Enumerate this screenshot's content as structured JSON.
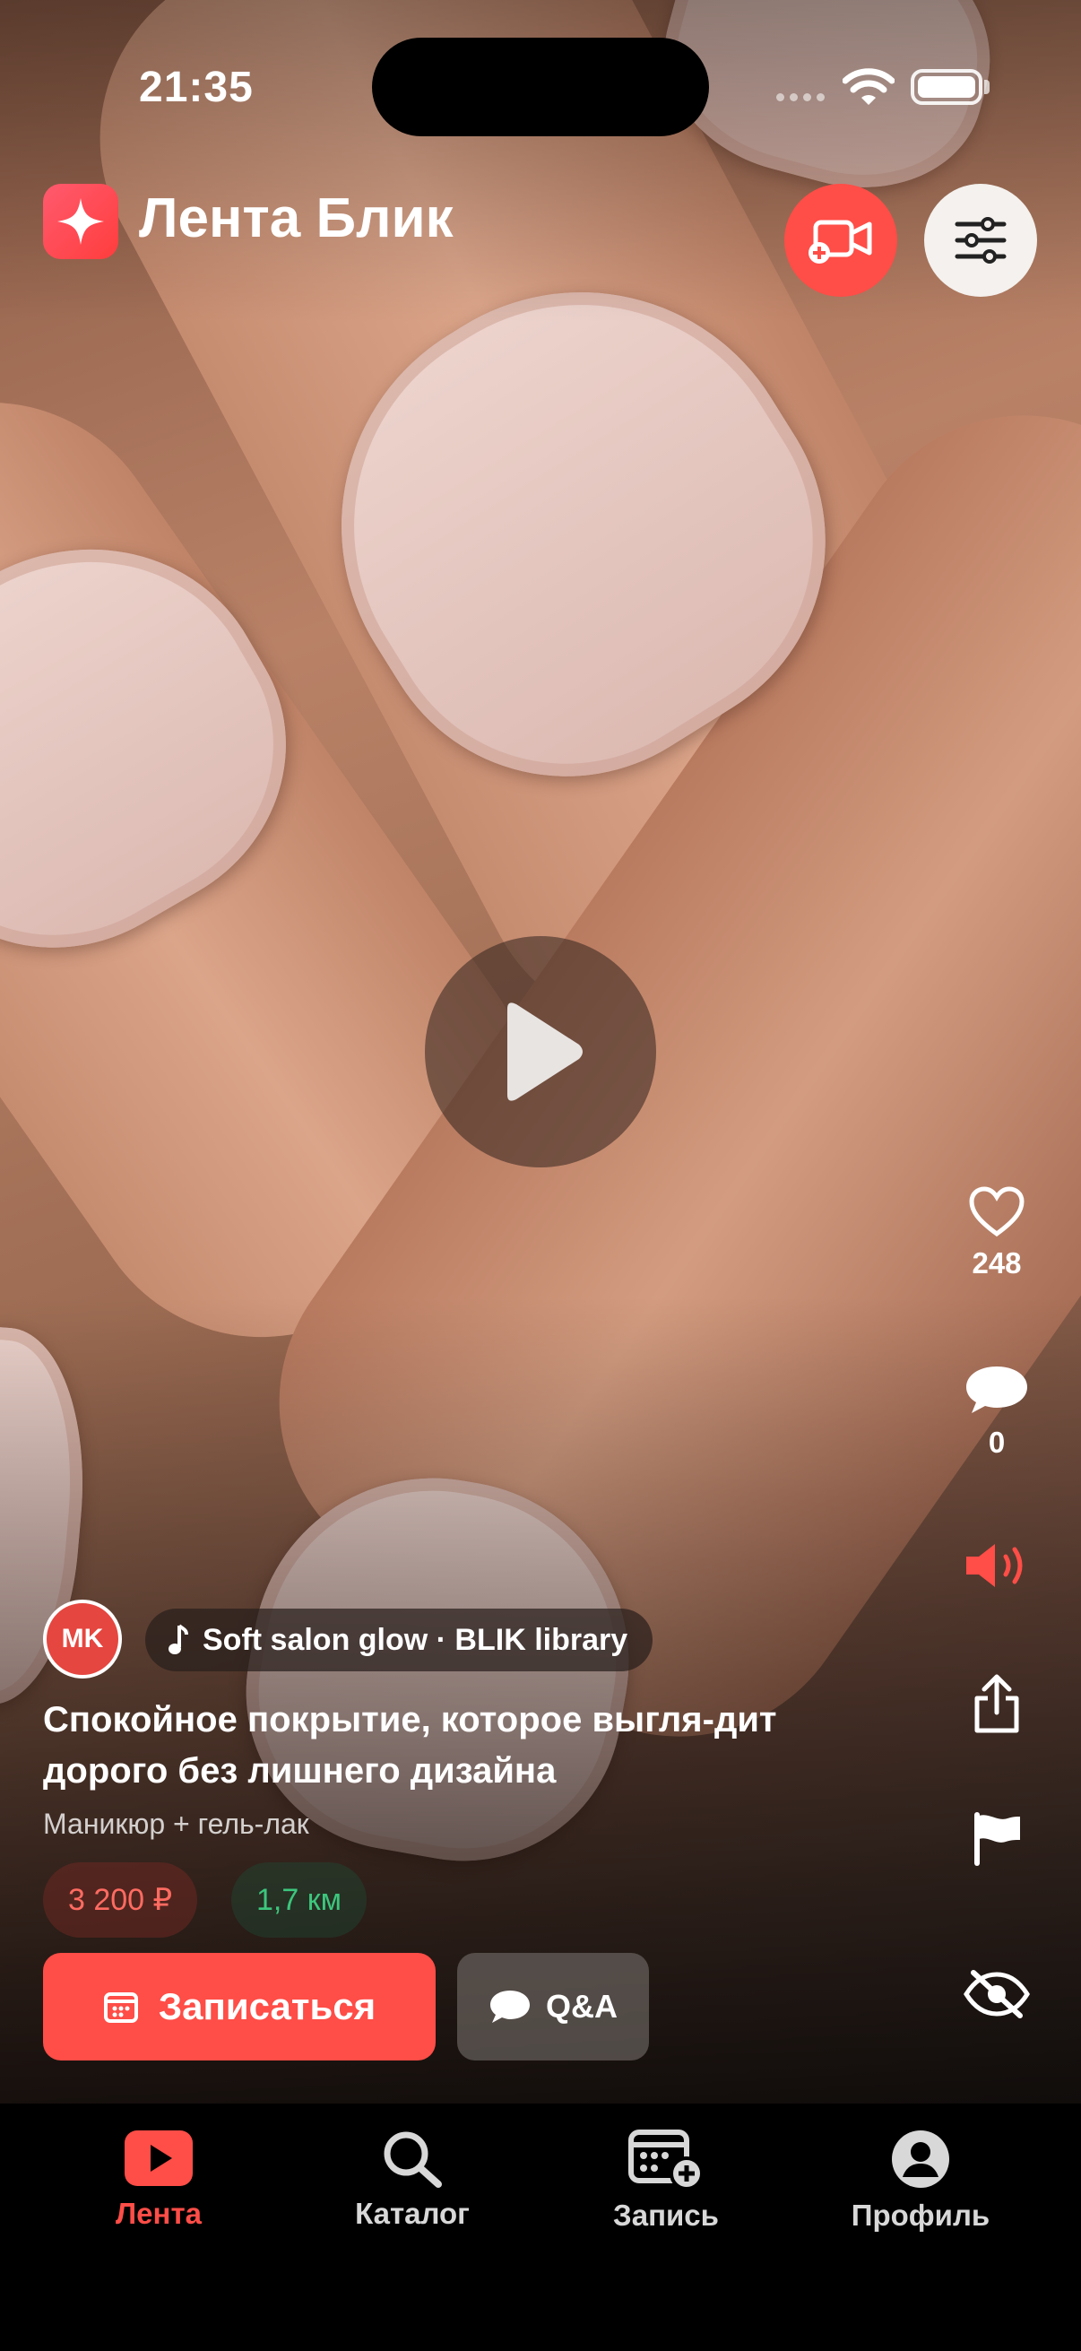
{
  "status_bar": {
    "time": "21:35"
  },
  "header": {
    "title": "Лента Блик"
  },
  "post": {
    "author_initials": "MK",
    "music": "Soft salon glow · BLIK library",
    "title": "Спокойное покрытие, которое выгля-дит дорого без лишнего дизайна",
    "subtitle": "Маникюр + гель-лак",
    "price": "3 200 ₽",
    "distance": "1,7 км",
    "book_label": "Записаться",
    "qa_label": "Q&A"
  },
  "actions": {
    "likes": "248",
    "comments": "0"
  },
  "tabs": [
    {
      "label": "Лента",
      "icon": "play-icon",
      "active": true
    },
    {
      "label": "Каталог",
      "icon": "search-icon",
      "active": false
    },
    {
      "label": "Запись",
      "icon": "calendar-add-icon",
      "active": false
    },
    {
      "label": "Профиль",
      "icon": "user-icon",
      "active": false
    }
  ],
  "colors": {
    "accent": "#ff4d47",
    "price": "#ff6b61",
    "distance": "#3cc67d"
  }
}
